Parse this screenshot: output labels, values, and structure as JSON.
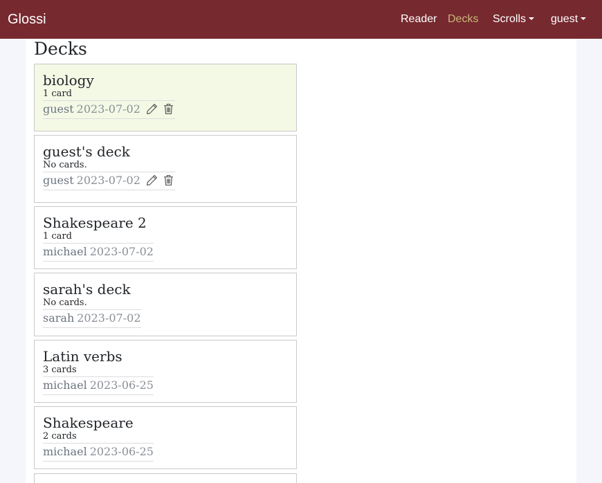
{
  "navbar": {
    "brand": "Glossi",
    "links": [
      {
        "label": "Reader"
      },
      {
        "label": "Decks",
        "active": true
      },
      {
        "label": "Scrolls",
        "dropdown": true
      },
      {
        "label": "guest",
        "dropdown": true
      }
    ],
    "background_color": "#76292f",
    "active_color": "#c9b77a"
  },
  "page": {
    "title": "Decks"
  },
  "decks": [
    {
      "name": "biology",
      "count": "1 card",
      "owner": "guest",
      "date": "2023-07-02",
      "editable": true,
      "selected": true
    },
    {
      "name": "guest's deck",
      "count": "No cards.",
      "owner": "guest",
      "date": "2023-07-02",
      "editable": true
    },
    {
      "name": "Shakespeare 2",
      "count": "1 card",
      "owner": "michael",
      "date": "2023-07-02"
    },
    {
      "name": "sarah's deck",
      "count": "No cards.",
      "owner": "sarah",
      "date": "2023-07-02"
    },
    {
      "name": "Latin verbs",
      "count": "3 cards",
      "owner": "michael",
      "date": "2023-06-25"
    },
    {
      "name": "Shakespeare",
      "count": "2 cards",
      "owner": "michael",
      "date": "2023-06-25"
    }
  ],
  "icons": {
    "edit": "pencil-icon",
    "delete": "trash-icon"
  },
  "colors": {
    "selected_deck_bg": "#f4f9e6"
  }
}
